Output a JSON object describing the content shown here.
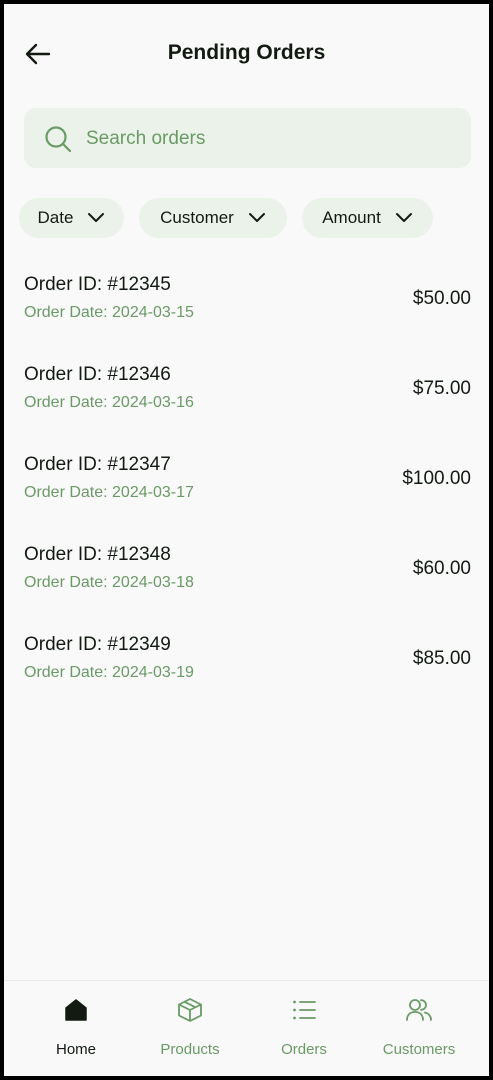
{
  "header": {
    "title": "Pending Orders"
  },
  "search": {
    "placeholder": "Search orders"
  },
  "filters": [
    {
      "label": "Date"
    },
    {
      "label": "Customer"
    },
    {
      "label": "Amount"
    }
  ],
  "orders": [
    {
      "id": "Order ID: #12345",
      "date": "Order Date: 2024-03-15",
      "amount": "$50.00"
    },
    {
      "id": "Order ID: #12346",
      "date": "Order Date: 2024-03-16",
      "amount": "$75.00"
    },
    {
      "id": "Order ID: #12347",
      "date": "Order Date: 2024-03-17",
      "amount": "$100.00"
    },
    {
      "id": "Order ID: #12348",
      "date": "Order Date: 2024-03-18",
      "amount": "$60.00"
    },
    {
      "id": "Order ID: #12349",
      "date": "Order Date: 2024-03-19",
      "amount": "$85.00"
    }
  ],
  "nav": [
    {
      "label": "Home",
      "icon": "home-icon",
      "active": true
    },
    {
      "label": "Products",
      "icon": "package-icon",
      "active": false
    },
    {
      "label": "Orders",
      "icon": "list-icon",
      "active": false
    },
    {
      "label": "Customers",
      "icon": "users-icon",
      "active": false
    }
  ],
  "colors": {
    "text": "#121a12",
    "accent": "#6a9a66",
    "chip_bg": "#ebf2ea",
    "background": "#f9f9f9"
  }
}
